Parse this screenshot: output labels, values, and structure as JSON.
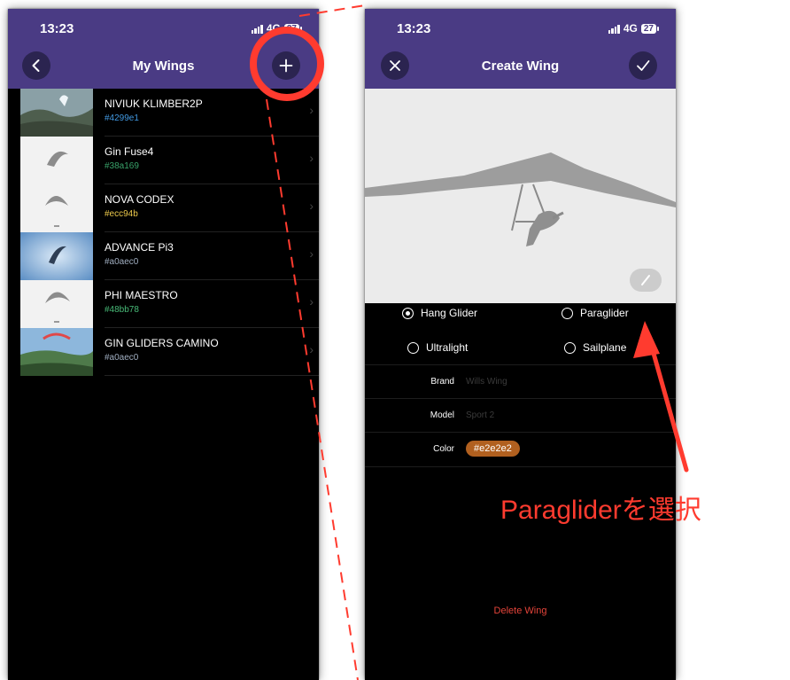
{
  "left_screen": {
    "status": {
      "time": "13:23",
      "network": "4G",
      "battery": "27"
    },
    "header": {
      "title": "My Wings",
      "back_icon": "chevron-left-icon",
      "add_icon": "plus-icon"
    },
    "wings": [
      {
        "name": "NIVIUK KLIMBER2P",
        "code": "#4299e1",
        "code_color": "#4299e1",
        "thumb": "photo-sky"
      },
      {
        "name": "Gin Fuse4",
        "code": "#38a169",
        "code_color": "#38a169",
        "thumb": "glider-silhouette"
      },
      {
        "name": "NOVA CODEX",
        "code": "#ecc94b",
        "code_color": "#ecc94b",
        "thumb": "glider-silhouette"
      },
      {
        "name": "ADVANCE Pi3",
        "code": "#a0aec0",
        "code_color": "#a0aec0",
        "thumb": "photo-blue-sky"
      },
      {
        "name": "PHI MAESTRO",
        "code": "#48bb78",
        "code_color": "#48bb78",
        "thumb": "glider-silhouette"
      },
      {
        "name": "GIN GLIDERS CAMINO",
        "code": "#a0aec0",
        "code_color": "#a0aec0",
        "thumb": "photo-landscape"
      }
    ]
  },
  "right_screen": {
    "status": {
      "time": "13:23",
      "network": "4G",
      "battery": "27"
    },
    "header": {
      "title": "Create Wing",
      "close_icon": "close-icon",
      "confirm_icon": "checkmark-icon"
    },
    "wing_types": [
      {
        "label": "Hang Glider",
        "selected": true
      },
      {
        "label": "Paraglider",
        "selected": false
      },
      {
        "label": "Ultralight",
        "selected": false
      },
      {
        "label": "Sailplane",
        "selected": false
      }
    ],
    "fields": {
      "brand": {
        "label": "Brand",
        "placeholder": "Wills Wing"
      },
      "model": {
        "label": "Model",
        "placeholder": "Sport 2"
      },
      "color": {
        "label": "Color",
        "value": "#e2e2e2",
        "chip_color": "#b1601f"
      }
    },
    "delete_label": "Delete Wing"
  },
  "annotation": {
    "text": "Paragliderを選択",
    "color": "#ff3b2f"
  },
  "colors": {
    "header": "#4a3b84",
    "header_button": "#2b2450",
    "screen_bg": "#000000"
  }
}
